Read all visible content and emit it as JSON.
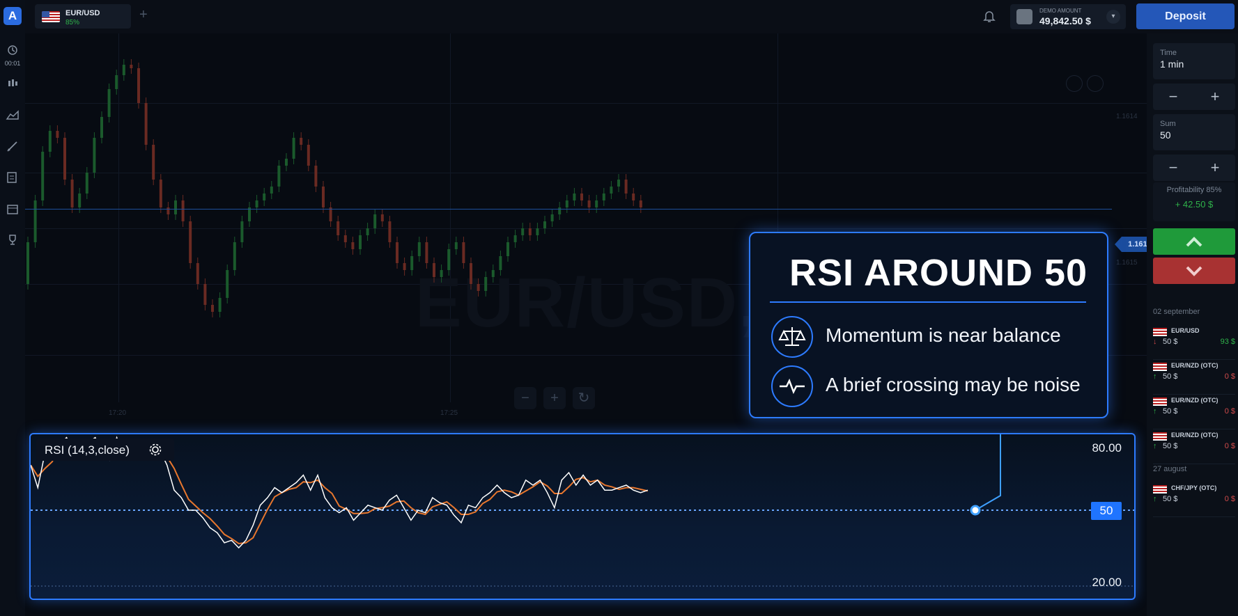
{
  "header": {
    "asset_name": "EUR/USD",
    "asset_payout": "85%",
    "add_tab": "+",
    "account_label": "DEMO AMOUNT",
    "account_balance": "49,842.50 $",
    "deposit_label": "Deposit"
  },
  "left_rail": {
    "logo": "A",
    "timer": "00:01",
    "icons": [
      "clock-icon",
      "candles-icon",
      "area-chart-icon",
      "drawing-icon",
      "indicators-icon",
      "calendar-icon",
      "trophy-icon"
    ]
  },
  "chart": {
    "current_price": "1.16127",
    "price_labels": [
      "1.1614",
      "1.1615"
    ],
    "time_labels": [
      "17:20",
      "17:25"
    ],
    "watermark": "EUR/USD, 5",
    "zoom_out": "−",
    "zoom_in": "+",
    "reset": "↻"
  },
  "rsi": {
    "label": "RSI (14,3,close)",
    "level_high": "80.00",
    "level_mid": "50",
    "level_low": "20.00",
    "rsi_line": [
      68,
      59,
      73,
      76,
      76,
      79,
      74,
      72,
      77,
      79,
      73,
      70,
      79,
      71,
      76,
      73,
      76,
      72,
      74,
      68,
      58,
      55,
      50,
      50,
      47,
      43,
      41,
      37,
      38,
      35,
      38,
      44,
      52,
      55,
      59,
      57,
      59,
      61,
      64,
      58,
      64,
      55,
      51,
      49,
      51,
      46,
      49,
      52,
      51,
      50,
      54,
      56,
      51,
      46,
      50,
      49,
      55,
      53,
      52,
      48,
      45,
      52,
      51,
      55,
      57,
      60,
      57,
      55,
      56,
      62,
      60,
      62,
      57,
      51,
      62,
      65,
      60,
      64,
      60,
      62,
      58,
      58,
      59,
      60,
      58,
      57,
      58
    ]
  },
  "callout": {
    "title": "RSI AROUND 50",
    "items": [
      "Momentum is near balance",
      "A brief crossing may be noise"
    ]
  },
  "right_panel": {
    "time_label": "Time",
    "time_value": "1 min",
    "sum_label": "Sum",
    "sum_value": "50",
    "minus": "−",
    "plus": "+",
    "profitability": "Profitability 85%",
    "payout": "+ 42.50 $",
    "history": [
      {
        "date": "02 september"
      },
      {
        "name": "EUR/USD",
        "amount": "50 $",
        "result": "93 $",
        "win": true
      },
      {
        "name": "EUR/NZD (OTC)",
        "amount": "50 $",
        "result": "0 $",
        "win": false
      },
      {
        "name": "EUR/NZD (OTC)",
        "amount": "50 $",
        "result": "0 $",
        "win": false
      },
      {
        "name": "EUR/NZD (OTC)",
        "amount": "50 $",
        "result": "0 $",
        "win": false
      },
      {
        "date": "27 august"
      },
      {
        "name": "CHF/JPY (OTC)",
        "amount": "50 $",
        "result": "0 $",
        "win": false
      }
    ]
  },
  "colors": {
    "accent": "#2d7bff",
    "up": "#1f9a3a",
    "down": "#a83232",
    "rsi_white": "#ffffff",
    "rsi_orange": "#e8772e"
  }
}
